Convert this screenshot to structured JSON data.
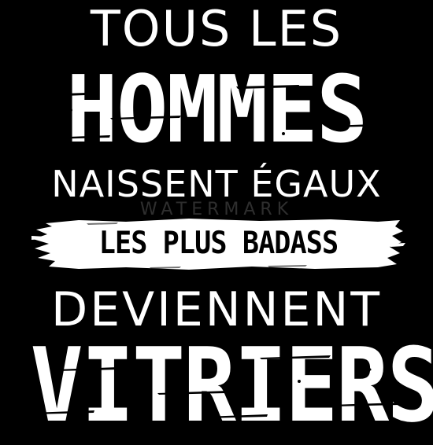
{
  "poster": {
    "line1": "TOUS LES",
    "line2": "HOMMES",
    "line3": "NAISSENT ÉGAUX",
    "line4": "LES PLUS BADASS",
    "line5": "DEVIENNENT",
    "line6": "VITRIERS",
    "watermark": "WATERMARK"
  },
  "colors": {
    "background": "#000000",
    "text": "#ffffff",
    "banner": "#ffffff",
    "banner_text": "#000000"
  }
}
